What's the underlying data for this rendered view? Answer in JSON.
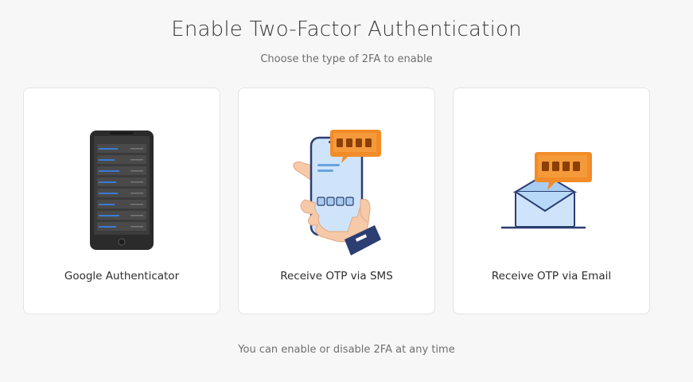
{
  "header": {
    "title": "Enable Two-Factor Authentication",
    "subtitle": "Choose the type of 2FA to enable"
  },
  "options": [
    {
      "label": "Google Authenticator",
      "icon": "authenticator-phone-icon"
    },
    {
      "label": "Receive OTP via SMS",
      "icon": "sms-phone-icon"
    },
    {
      "label": "Receive OTP via Email",
      "icon": "email-envelope-icon"
    }
  ],
  "footer": {
    "note": "You can enable or disable 2FA at any time"
  },
  "colors": {
    "accent_orange": "#f28c28",
    "phone_blue": "#cfe4fb",
    "outline_navy": "#2c3e72",
    "phone_dark": "#2b2b2b"
  }
}
